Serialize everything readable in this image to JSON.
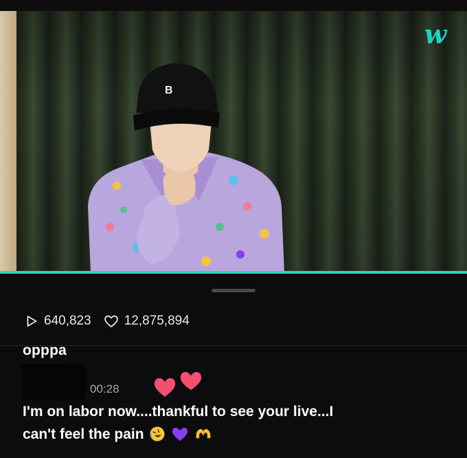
{
  "video": {
    "brand_logo": "w",
    "accent_color": "#26d7c2"
  },
  "stats": {
    "plays": "640,823",
    "likes": "12,875,894",
    "play_icon": "play-icon",
    "like_icon": "heart-outline-icon"
  },
  "comment": {
    "username": "opppa",
    "timestamp": "00:28",
    "line1": "I'm on labor now....thankful to see your live...I",
    "line2": "can't feel the pain",
    "emojis": [
      "rolling-laughing-emoji",
      "purple-heart-emoji",
      "heart-hands-emoji"
    ],
    "reaction_icon": "pink-hearts-icon"
  },
  "colors": {
    "background": "#0c0c0e",
    "accent": "#26d7c2",
    "heart_pink": "#f0506e",
    "purple_heart": "#8a3cf0"
  }
}
